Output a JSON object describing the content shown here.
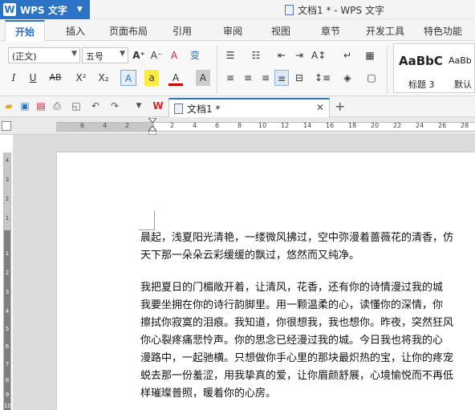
{
  "app": {
    "name": "WPS 文字",
    "logo": "W",
    "window_title": "文档1 * - WPS 文字"
  },
  "ribbon_tabs": [
    "开始",
    "插入",
    "页面布局",
    "引用",
    "审阅",
    "视图",
    "章节",
    "开发工具",
    "特色功能"
  ],
  "ribbon": {
    "font_name": "(正文)",
    "font_size": "五号",
    "style_preview_1": "AaBbC",
    "style_preview_2": "AaBb",
    "style_label_1": "标题 3",
    "style_label_2": "默认"
  },
  "doc_tab": {
    "label": "文档1 *"
  },
  "ruler_h_numbers": [
    "6",
    "4",
    "2",
    "2",
    "4",
    "6",
    "8",
    "10",
    "12",
    "14",
    "16",
    "18",
    "20",
    "22",
    "24",
    "26",
    "28"
  ],
  "ruler_v_numbers": [
    "4",
    "3",
    "2",
    "1",
    "1",
    "2",
    "3",
    "4",
    "5",
    "6",
    "7",
    "8",
    "9",
    "10"
  ],
  "document": {
    "paragraph_1": [
      "晨起，浅夏阳光清艳，一缕微风拂过，空中弥漫着蔷薇花的清香，仿",
      "天下那一朵朵云彩缓缓的飘过，悠然而又纯净。"
    ],
    "paragraph_2": [
      "我把夏日的门楣敞开着，让清风，花香，还有你的诗情漫过我的城",
      "我要坐拥在你的诗行韵脚里。用一颗温柔的心，读懂你的深情，你",
      "擦拭你寂寞的泪痕。我知道，你很想我，我也想你。昨夜，突然狂风",
      "你心裂疼痛悲怜声。你的思念已经漫过我的城。今日我也将我的心",
      "漫路中，一起驰横。只想做你手心里的那块最炽热的宝，让你的疼宠",
      "蜕去那一份羞涩，用我挚真的爱，让你眉颜舒展，心境愉悦而不再低",
      "样璀璨普照，暖着你的心房。"
    ]
  }
}
